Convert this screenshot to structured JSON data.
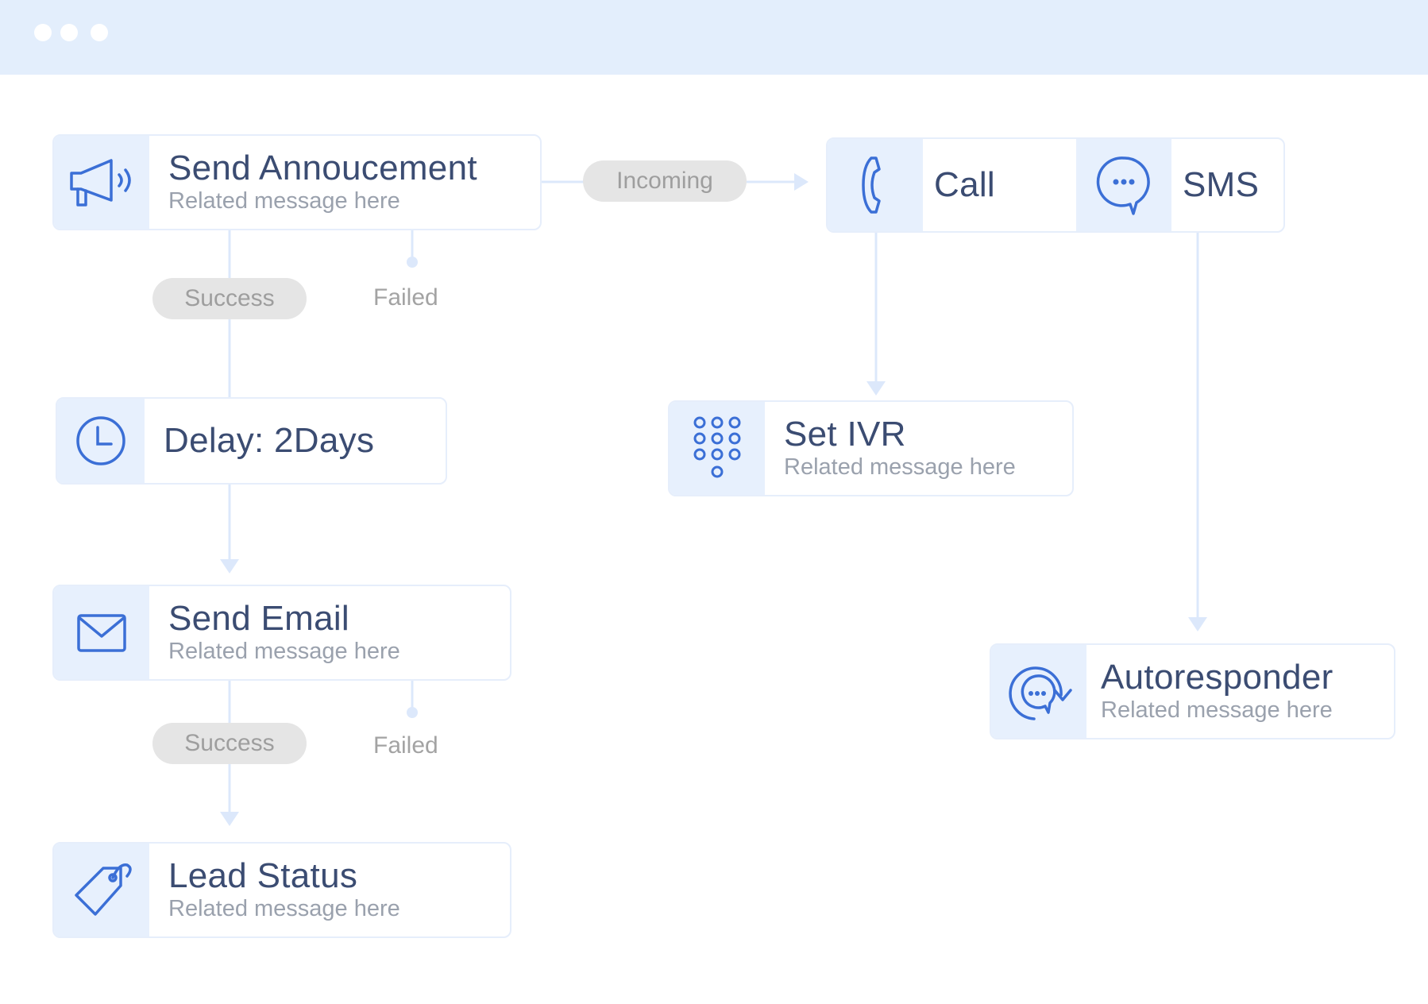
{
  "nodes": {
    "announcement": {
      "title": "Send Annoucement",
      "subtitle": "Related message here"
    },
    "delay": {
      "title": "Delay: 2Days"
    },
    "email": {
      "title": "Send Email",
      "subtitle": "Related message here"
    },
    "lead_status": {
      "title": "Lead Status",
      "subtitle": "Related message here"
    },
    "call": {
      "title": "Call"
    },
    "sms": {
      "title": "SMS"
    },
    "ivr": {
      "title": "Set IVR",
      "subtitle": "Related message here"
    },
    "autoresponder": {
      "title": "Autoresponder",
      "subtitle": "Related message here"
    }
  },
  "edges": {
    "incoming": "Incoming",
    "announcement_success": "Success",
    "announcement_failed": "Failed",
    "email_success": "Success",
    "email_failed": "Failed"
  },
  "icons": {
    "announcement": "megaphone-icon",
    "delay": "clock-icon",
    "email": "envelope-icon",
    "lead_status": "tag-icon",
    "call": "phone-icon",
    "sms": "chat-bubble-icon",
    "ivr": "keypad-icon",
    "autoresponder": "auto-reply-icon"
  },
  "colors": {
    "accent": "#3b6fd6",
    "title_text": "#3b4c72",
    "icon_panel": "#e7f0fd",
    "connector": "#dce8fb",
    "pill_bg": "#e5e5e5"
  }
}
